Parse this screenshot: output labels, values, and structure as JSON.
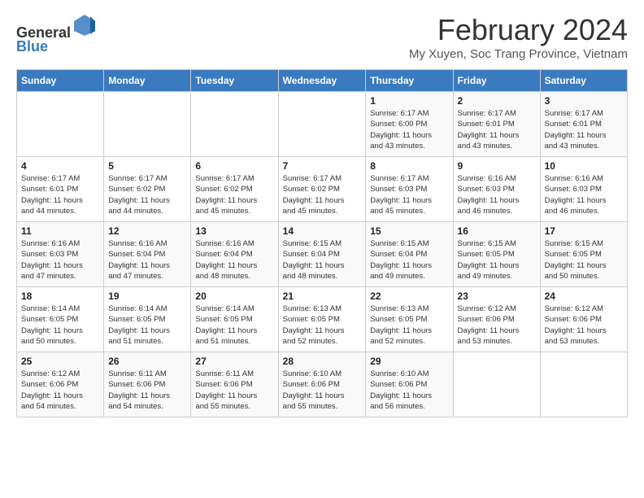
{
  "header": {
    "logo_general": "General",
    "logo_blue": "Blue",
    "title": "February 2024",
    "subtitle": "My Xuyen, Soc Trang Province, Vietnam"
  },
  "calendar": {
    "days_of_week": [
      "Sunday",
      "Monday",
      "Tuesday",
      "Wednesday",
      "Thursday",
      "Friday",
      "Saturday"
    ],
    "weeks": [
      [
        {
          "day": "",
          "info": ""
        },
        {
          "day": "",
          "info": ""
        },
        {
          "day": "",
          "info": ""
        },
        {
          "day": "",
          "info": ""
        },
        {
          "day": "1",
          "info": "Sunrise: 6:17 AM\nSunset: 6:00 PM\nDaylight: 11 hours\nand 43 minutes."
        },
        {
          "day": "2",
          "info": "Sunrise: 6:17 AM\nSunset: 6:01 PM\nDaylight: 11 hours\nand 43 minutes."
        },
        {
          "day": "3",
          "info": "Sunrise: 6:17 AM\nSunset: 6:01 PM\nDaylight: 11 hours\nand 43 minutes."
        }
      ],
      [
        {
          "day": "4",
          "info": "Sunrise: 6:17 AM\nSunset: 6:01 PM\nDaylight: 11 hours\nand 44 minutes."
        },
        {
          "day": "5",
          "info": "Sunrise: 6:17 AM\nSunset: 6:02 PM\nDaylight: 11 hours\nand 44 minutes."
        },
        {
          "day": "6",
          "info": "Sunrise: 6:17 AM\nSunset: 6:02 PM\nDaylight: 11 hours\nand 45 minutes."
        },
        {
          "day": "7",
          "info": "Sunrise: 6:17 AM\nSunset: 6:02 PM\nDaylight: 11 hours\nand 45 minutes."
        },
        {
          "day": "8",
          "info": "Sunrise: 6:17 AM\nSunset: 6:03 PM\nDaylight: 11 hours\nand 45 minutes."
        },
        {
          "day": "9",
          "info": "Sunrise: 6:16 AM\nSunset: 6:03 PM\nDaylight: 11 hours\nand 46 minutes."
        },
        {
          "day": "10",
          "info": "Sunrise: 6:16 AM\nSunset: 6:03 PM\nDaylight: 11 hours\nand 46 minutes."
        }
      ],
      [
        {
          "day": "11",
          "info": "Sunrise: 6:16 AM\nSunset: 6:03 PM\nDaylight: 11 hours\nand 47 minutes."
        },
        {
          "day": "12",
          "info": "Sunrise: 6:16 AM\nSunset: 6:04 PM\nDaylight: 11 hours\nand 47 minutes."
        },
        {
          "day": "13",
          "info": "Sunrise: 6:16 AM\nSunset: 6:04 PM\nDaylight: 11 hours\nand 48 minutes."
        },
        {
          "day": "14",
          "info": "Sunrise: 6:15 AM\nSunset: 6:04 PM\nDaylight: 11 hours\nand 48 minutes."
        },
        {
          "day": "15",
          "info": "Sunrise: 6:15 AM\nSunset: 6:04 PM\nDaylight: 11 hours\nand 49 minutes."
        },
        {
          "day": "16",
          "info": "Sunrise: 6:15 AM\nSunset: 6:05 PM\nDaylight: 11 hours\nand 49 minutes."
        },
        {
          "day": "17",
          "info": "Sunrise: 6:15 AM\nSunset: 6:05 PM\nDaylight: 11 hours\nand 50 minutes."
        }
      ],
      [
        {
          "day": "18",
          "info": "Sunrise: 6:14 AM\nSunset: 6:05 PM\nDaylight: 11 hours\nand 50 minutes."
        },
        {
          "day": "19",
          "info": "Sunrise: 6:14 AM\nSunset: 6:05 PM\nDaylight: 11 hours\nand 51 minutes."
        },
        {
          "day": "20",
          "info": "Sunrise: 6:14 AM\nSunset: 6:05 PM\nDaylight: 11 hours\nand 51 minutes."
        },
        {
          "day": "21",
          "info": "Sunrise: 6:13 AM\nSunset: 6:05 PM\nDaylight: 11 hours\nand 52 minutes."
        },
        {
          "day": "22",
          "info": "Sunrise: 6:13 AM\nSunset: 6:05 PM\nDaylight: 11 hours\nand 52 minutes."
        },
        {
          "day": "23",
          "info": "Sunrise: 6:12 AM\nSunset: 6:06 PM\nDaylight: 11 hours\nand 53 minutes."
        },
        {
          "day": "24",
          "info": "Sunrise: 6:12 AM\nSunset: 6:06 PM\nDaylight: 11 hours\nand 53 minutes."
        }
      ],
      [
        {
          "day": "25",
          "info": "Sunrise: 6:12 AM\nSunset: 6:06 PM\nDaylight: 11 hours\nand 54 minutes."
        },
        {
          "day": "26",
          "info": "Sunrise: 6:11 AM\nSunset: 6:06 PM\nDaylight: 11 hours\nand 54 minutes."
        },
        {
          "day": "27",
          "info": "Sunrise: 6:11 AM\nSunset: 6:06 PM\nDaylight: 11 hours\nand 55 minutes."
        },
        {
          "day": "28",
          "info": "Sunrise: 6:10 AM\nSunset: 6:06 PM\nDaylight: 11 hours\nand 55 minutes."
        },
        {
          "day": "29",
          "info": "Sunrise: 6:10 AM\nSunset: 6:06 PM\nDaylight: 11 hours\nand 56 minutes."
        },
        {
          "day": "",
          "info": ""
        },
        {
          "day": "",
          "info": ""
        }
      ]
    ]
  },
  "colors": {
    "header_bg": "#3a7abf",
    "accent": "#3a7abf"
  }
}
